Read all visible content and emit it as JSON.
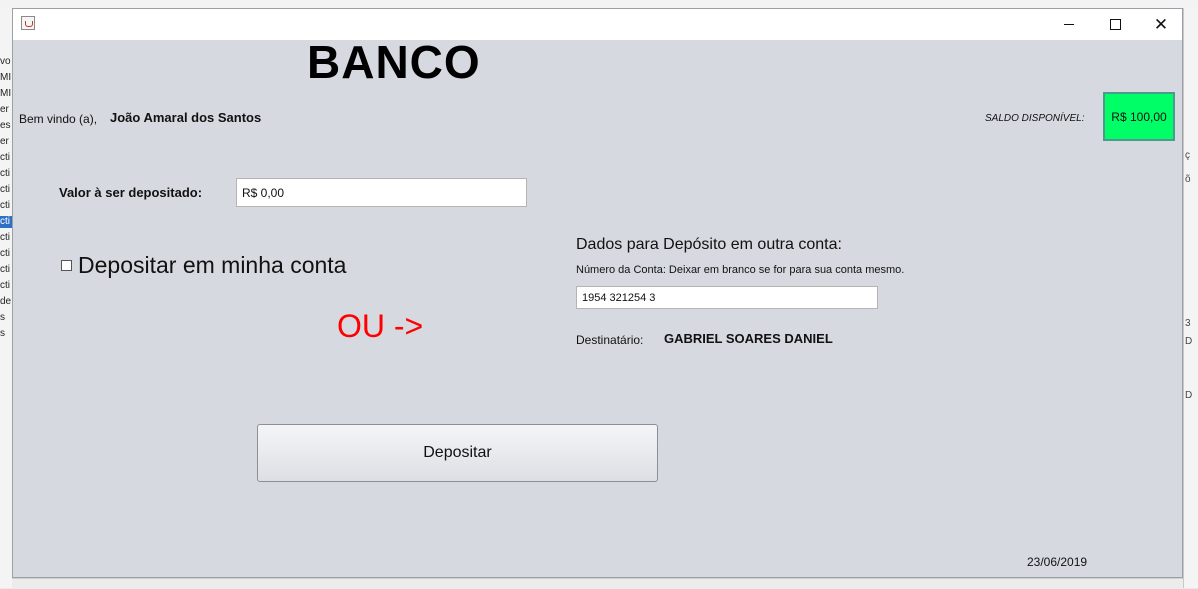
{
  "window": {
    "title": "",
    "controls": {
      "minimize": "—",
      "maximize": "☐",
      "close": "✕"
    }
  },
  "header": {
    "title": "BANCO",
    "welcome_label": "Bem vindo (a),",
    "user_name": "João Amaral dos Santos",
    "saldo_label": "SALDO DISPONÍVEL:",
    "saldo_value": "R$ 100,00"
  },
  "form": {
    "valor_label": "Valor à ser depositado:",
    "valor_value": "R$ 0,00",
    "checkbox_label": "Depositar em minha conta",
    "checkbox_checked": false,
    "ou_text": "OU ->",
    "dados_title": "Dados para Depósito em outra conta:",
    "conta_label": "Número da Conta:  Deixar em branco se for para sua conta mesmo.",
    "conta_value": "1954 321254 3",
    "destinatario_label": "Destinatário:",
    "destinatario_name": "GABRIEL SOARES DANIEL",
    "deposit_button": "Depositar"
  },
  "footer": {
    "date": "23/06/2019"
  },
  "colors": {
    "window_bg": "#d6d9df",
    "saldo_bg": "#00ff66",
    "ou_color": "#ff0000"
  }
}
